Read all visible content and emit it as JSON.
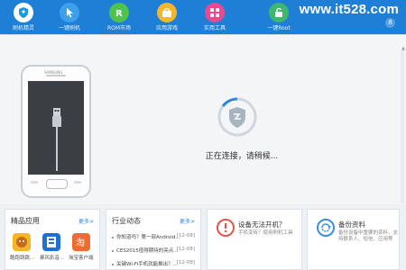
{
  "toolbar": {
    "items": [
      {
        "label": "刷机精灵",
        "icon": "shield-logo-icon",
        "color": "#1a9be0"
      },
      {
        "label": "一键刷机",
        "icon": "cursor-icon",
        "color": "#3ea0ec"
      },
      {
        "label": "ROM市场",
        "icon": "rom-market-icon",
        "color": "#4fc24f"
      },
      {
        "label": "应用游戏",
        "icon": "app-store-icon",
        "color": "#f3b631"
      },
      {
        "label": "实用工具",
        "icon": "toolbox-icon",
        "color": "#e84a8f"
      },
      {
        "label": "一键Root",
        "icon": "root-icon",
        "color": "#3fb66d"
      }
    ],
    "watermark": "www.it528.com",
    "update_badge": "8"
  },
  "device": {
    "brand_text": "SAMSUNG"
  },
  "status": {
    "text": "正在连接，请稍候..."
  },
  "panels": {
    "apps": {
      "title": "精品应用",
      "more": "更多>",
      "items": [
        {
          "label": "酷跑跳跳...",
          "color": "#f5b623"
        },
        {
          "label": "暴风影音...",
          "color": "#1e6fd1"
        },
        {
          "label": "淘宝客户端",
          "color": "#f06b2d"
        }
      ]
    },
    "news": {
      "title": "行业动态",
      "more": "更多>",
      "items": [
        {
          "text": "你知道吗？第一部Android...",
          "date": "[12-08]"
        },
        {
          "text": "CES2015值得期待的亮点...",
          "date": "[12-08]"
        },
        {
          "text": "关键Wi-Fi手机就能推出？...",
          "date": "[12-08]"
        }
      ]
    },
    "card1": {
      "title": "设备无法开机？",
      "desc": "手机变砖？使用刷机工具",
      "icon_color": "#e8534a"
    },
    "card2": {
      "title": "备份资料",
      "desc": "备份设备中重要的资料，支持联系人、短信、应用等",
      "icon_color": "#3b8fe2"
    }
  }
}
